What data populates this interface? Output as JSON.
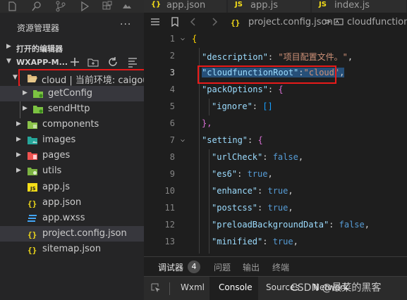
{
  "activity_bar": {
    "icons": [
      "explorer-icon",
      "search-icon",
      "source-control-icon",
      "debug-icon",
      "extensions-icon",
      "remote-icon"
    ]
  },
  "sidebar": {
    "title": "资源管理器",
    "more": "···",
    "open_editors_label": "打开的编辑器",
    "project_label": "WXAPP-M...",
    "tree": [
      {
        "label": "cloud | 当前环境: caigou",
        "type": "folder-open",
        "expanded": true
      },
      {
        "label": "getConfig",
        "type": "cloud-func-folder",
        "expanded": false
      },
      {
        "label": "sendHttp",
        "type": "cloud-func-folder",
        "expanded": false
      },
      {
        "label": "components",
        "type": "folder",
        "expanded": false
      },
      {
        "label": "images",
        "type": "folder",
        "expanded": false
      },
      {
        "label": "pages",
        "type": "folder",
        "expanded": false
      },
      {
        "label": "utils",
        "type": "folder",
        "expanded": false
      },
      {
        "label": "app.js",
        "type": "js"
      },
      {
        "label": "app.json",
        "type": "json"
      },
      {
        "label": "app.wxss",
        "type": "css"
      },
      {
        "label": "project.config.json",
        "type": "json"
      },
      {
        "label": "sitemap.json",
        "type": "json"
      }
    ]
  },
  "tabs": [
    {
      "icon": "{}",
      "label": "app.json"
    },
    {
      "icon": "JS",
      "label": "app.js"
    },
    {
      "icon": "JS",
      "label": "index.js"
    }
  ],
  "breadcrumb": {
    "file": "project.config.json",
    "separator": ">",
    "item": "cloudfunctionR"
  },
  "code": {
    "lines": [
      {
        "n": "1",
        "text": "{"
      },
      {
        "n": "2",
        "key": "\"description\"",
        "value": "\"项目配置文件。\""
      },
      {
        "n": "3",
        "key": "\"cloudfunctionRoot\"",
        "value": "\"cloud\""
      },
      {
        "n": "4",
        "key": "\"packOptions\"",
        "text": "{"
      },
      {
        "n": "5",
        "key": "\"ignore\"",
        "text": "[]"
      },
      {
        "n": "6",
        "text": "},"
      },
      {
        "n": "7",
        "key": "\"setting\"",
        "text": "{"
      },
      {
        "n": "8",
        "key": "\"urlCheck\"",
        "value": "false"
      },
      {
        "n": "9",
        "key": "\"es6\"",
        "value": "true"
      },
      {
        "n": "10",
        "key": "\"enhance\"",
        "value": "true"
      },
      {
        "n": "11",
        "key": "\"postcss\"",
        "value": "true"
      },
      {
        "n": "12",
        "key": "\"preloadBackgroundData\"",
        "value": "false"
      },
      {
        "n": "13",
        "key": "\"minified\"",
        "value": "true"
      }
    ]
  },
  "panel": {
    "tabs": [
      "调试器",
      "问题",
      "输出",
      "终端"
    ],
    "badge": "4"
  },
  "devtools": {
    "tabs": [
      "Wxml",
      "Console",
      "Sources",
      "Network"
    ],
    "active": "Console"
  },
  "watermark": "CSDN @最菜的黑客",
  "colors": {
    "highlight_box": "#e81a1a",
    "selection": "#264f78",
    "json_key": "#9cdcfe",
    "json_string": "#ce9178",
    "json_bool": "#569cd6"
  }
}
